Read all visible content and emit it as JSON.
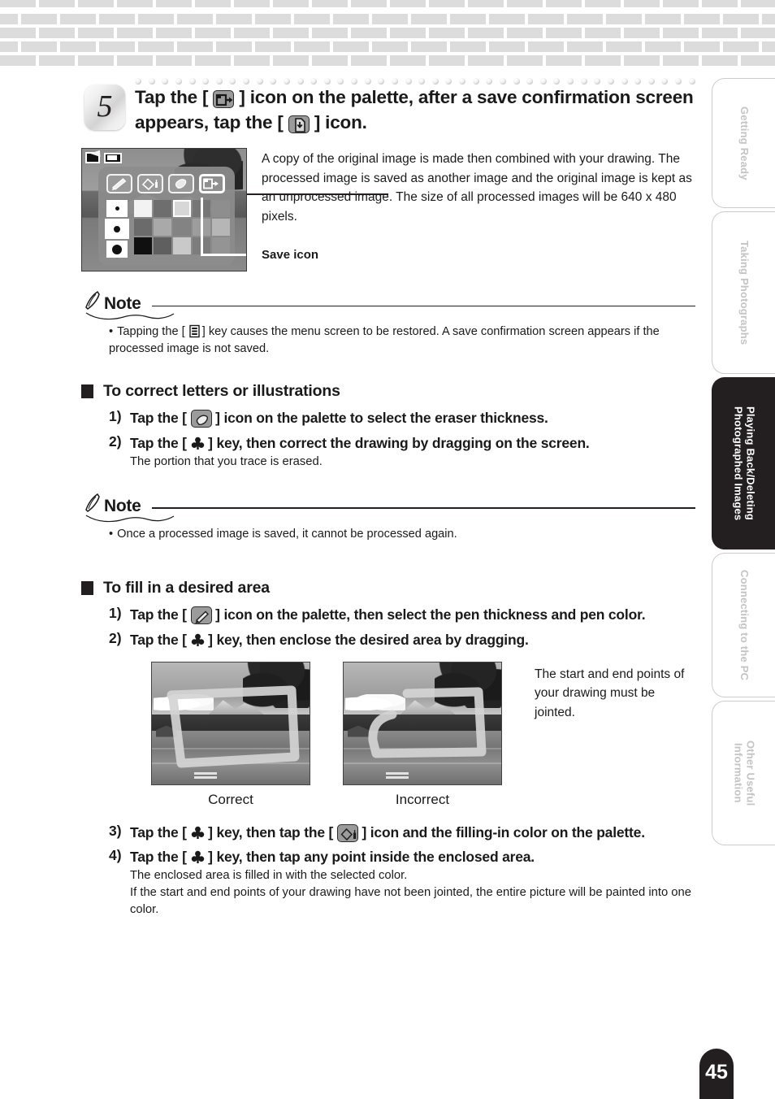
{
  "page": {
    "number": "45"
  },
  "sidebar": {
    "tabs": [
      {
        "label": "Getting Ready",
        "active": false
      },
      {
        "label": "Taking Photographs",
        "active": false
      },
      {
        "label": "Playing Back/Deleting Photographed Images",
        "active": true
      },
      {
        "label": "Connecting to the PC",
        "active": false
      },
      {
        "label": "Other Useful Information",
        "active": false
      }
    ]
  },
  "step": {
    "number": "5",
    "title_part1": "Tap the [",
    "title_icon1": "save-icon",
    "title_part2": "] icon on the palette, after a save confirmation screen appears, tap the [",
    "title_icon2": "save-confirm-icon",
    "title_part3": "] icon."
  },
  "figure": {
    "body": "A copy of the original image is made then combined with your drawing. The processed image is saved as another image and the original image is kept as an unprocessed image. The size of all processed images will be 640 x 480 pixels.",
    "callout_label": "Save icon",
    "palette": {
      "tools": [
        "pen-icon",
        "paint-bucket-icon",
        "eraser-icon",
        "save-icon"
      ],
      "selected_tool": "save-icon",
      "thickness": [
        "thin",
        "medium",
        "thick"
      ],
      "selected_thickness": "medium",
      "swatch_colors": [
        "#f2f2f2",
        "#6e6e6e",
        "#d7d7d7",
        "#767676",
        "#8e8e8e",
        "#6b6b6b",
        "#a9a9a9",
        "#838383",
        "#9d9d9d",
        "#b6b6b6",
        "#101010",
        "#5f5f5f",
        "#c9c9c9",
        "#7c7c7c",
        "#949494"
      ],
      "selected_swatch_index": 2
    }
  },
  "notes": [
    {
      "heading": "Note",
      "text_part1": "Tapping the [",
      "icon": "menu-key-icon",
      "text_part2": "] key causes the menu screen to be restored. A save confirmation screen appears if the processed image is not saved."
    },
    {
      "heading": "Note",
      "text": "Once a processed image is saved, it cannot be processed again."
    }
  ],
  "sections": [
    {
      "title": "To correct letters or illustrations",
      "steps": [
        {
          "num": "1)",
          "part1": "Tap the [",
          "icon": "eraser-icon",
          "part2": "] icon on the palette to select the eraser thickness.",
          "sub": ""
        },
        {
          "num": "2)",
          "part1": "Tap the [",
          "icon": "shutter-key-icon",
          "part2": "] key, then correct the drawing by dragging on the screen.",
          "sub": "The portion that you trace is erased."
        }
      ]
    },
    {
      "title": "To fill in a desired area",
      "steps": [
        {
          "num": "1)",
          "part1": "Tap the [",
          "icon": "pen-icon",
          "part2": "] icon on the palette, then select the pen thickness and pen color.",
          "sub": ""
        },
        {
          "num": "2)",
          "part1": "Tap the [",
          "icon": "shutter-key-icon",
          "part2": "] key, then enclose the desired area by dragging.",
          "sub": ""
        },
        {
          "num": "3)",
          "part1": "Tap the [",
          "icon": "shutter-key-icon",
          "part2": "] key, then tap the [",
          "icon2": "paint-bucket-icon",
          "part3": "] icon and the filling-in color on the palette.",
          "sub": ""
        },
        {
          "num": "4)",
          "part1": "Tap the [",
          "icon": "shutter-key-icon",
          "part2": "] key, then tap any point inside the enclosed area.",
          "sub": "The enclosed area is filled in with the selected color.\nIf the start and end points of your drawing have not been jointed, the entire picture will be painted into one color."
        }
      ]
    }
  ],
  "examples": {
    "correct_caption": "Correct",
    "incorrect_caption": "Incorrect",
    "note": "The start and end points of your drawing must be jointed."
  },
  "colors": {
    "accent_dark": "#231f20",
    "brick": "#dcdcdc",
    "tab_inactive_text": "#c4c4c4"
  }
}
